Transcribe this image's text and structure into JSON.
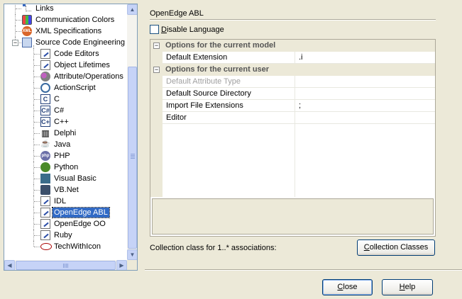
{
  "tree": {
    "items": [
      {
        "label": "Links",
        "icon": "links-icon",
        "depth": 1
      },
      {
        "label": "Communication Colors",
        "icon": "color-palette-icon",
        "depth": 1
      },
      {
        "label": "XML Specifications",
        "icon": "xml-icon",
        "depth": 1
      },
      {
        "label": "Source Code Engineering",
        "icon": "source-code-folder-icon",
        "depth": 1,
        "expanded": true
      },
      {
        "label": "Code Editors",
        "icon": "document-icon",
        "depth": 2
      },
      {
        "label": "Object Lifetimes",
        "icon": "document-icon",
        "depth": 2
      },
      {
        "label": "Attribute/Operations",
        "icon": "attribute-icon",
        "depth": 2
      },
      {
        "label": "ActionScript",
        "icon": "actionscript-icon",
        "depth": 2
      },
      {
        "label": "C",
        "icon": "c-language-icon",
        "depth": 2
      },
      {
        "label": "C#",
        "icon": "csharp-icon",
        "depth": 2
      },
      {
        "label": "C++",
        "icon": "cpp-icon",
        "depth": 2
      },
      {
        "label": "Delphi",
        "icon": "delphi-icon",
        "depth": 2
      },
      {
        "label": "Java",
        "icon": "java-icon",
        "depth": 2
      },
      {
        "label": "PHP",
        "icon": "php-icon",
        "depth": 2
      },
      {
        "label": "Python",
        "icon": "python-icon",
        "depth": 2
      },
      {
        "label": "Visual Basic",
        "icon": "visual-basic-icon",
        "depth": 2
      },
      {
        "label": "VB.Net",
        "icon": "vbnet-icon",
        "depth": 2
      },
      {
        "label": "IDL",
        "icon": "document-icon",
        "depth": 2
      },
      {
        "label": "OpenEdge ABL",
        "icon": "document-icon",
        "depth": 2,
        "selected": true
      },
      {
        "label": "OpenEdge OO",
        "icon": "document-icon",
        "depth": 2
      },
      {
        "label": "Ruby",
        "icon": "document-icon",
        "depth": 2
      },
      {
        "label": "TechWithIcon",
        "icon": "techwithicon-icon",
        "depth": 2
      }
    ]
  },
  "page": {
    "title": "OpenEdge ABL",
    "disable_language_prefix": "D",
    "disable_language_rest": "isable Language",
    "disable_language_checked": false
  },
  "grid": {
    "groups": [
      {
        "title": "Options for the current model",
        "expander": "⊟",
        "rows": [
          {
            "name": "Default Extension",
            "value": ".i",
            "disabled": false
          }
        ]
      },
      {
        "title": "Options for the current user",
        "expander": "⊟",
        "rows": [
          {
            "name": "Default Attribute Type",
            "value": "",
            "disabled": true
          },
          {
            "name": "Default Source Directory",
            "value": "",
            "disabled": false
          },
          {
            "name": "Import File Extensions",
            "value": ";",
            "disabled": false
          },
          {
            "name": "Editor",
            "value": "",
            "disabled": false
          }
        ]
      }
    ]
  },
  "collection": {
    "label": "Collection class for 1..* associations:",
    "button_prefix": "C",
    "button_rest": "ollection Classes"
  },
  "footer": {
    "close_prefix": "C",
    "close_rest": "lose",
    "help_prefix": "H",
    "help_rest": "elp"
  }
}
